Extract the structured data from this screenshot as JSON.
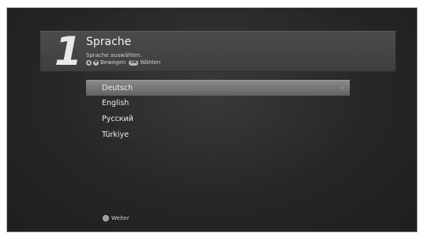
{
  "header": {
    "step_number": "1",
    "title": "Sprache",
    "subtitle": "Sprache auswählen.",
    "hint_move": "Bewegen",
    "hint_ok_key": "OK",
    "hint_select": "Wählen"
  },
  "languages": [
    {
      "label": "Deutsch",
      "selected": true
    },
    {
      "label": "English",
      "selected": false
    },
    {
      "label": "Русский",
      "selected": false
    },
    {
      "label": "Türkiye",
      "selected": false
    }
  ],
  "footer": {
    "next_label": "Weiter"
  },
  "icons": {
    "up": "triangle-up-icon",
    "down": "triangle-down-icon",
    "chevron": "chevron-right-icon",
    "color_button": "color-key-icon"
  }
}
